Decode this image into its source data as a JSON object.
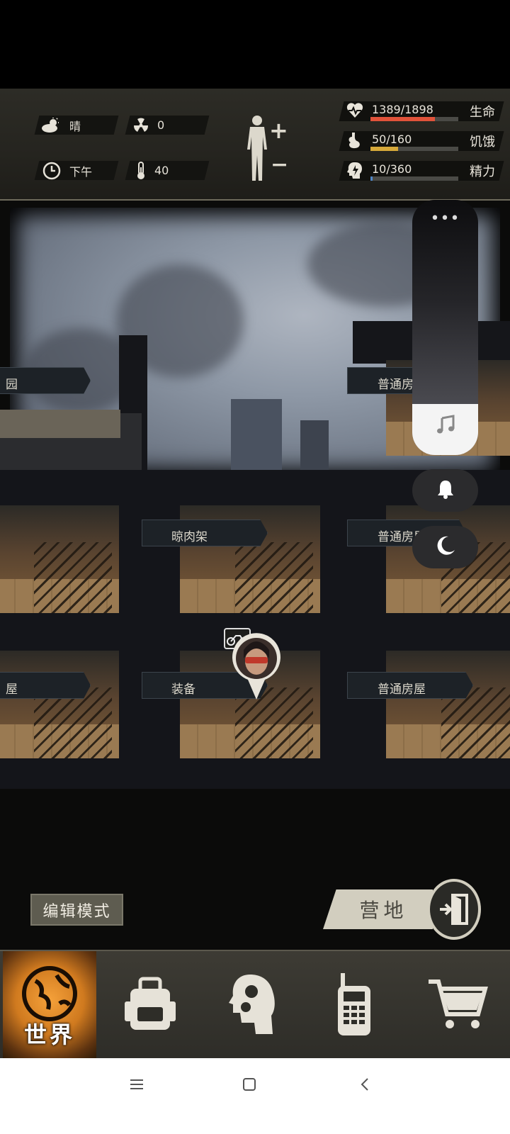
{
  "status": {
    "weather": {
      "icon": "cloud-sun-icon",
      "label": "晴"
    },
    "radiation": {
      "icon": "radiation-icon",
      "value": "0"
    },
    "time": {
      "icon": "clock-icon",
      "label": "下午"
    },
    "temperature": {
      "icon": "thermometer-icon",
      "value": "40"
    },
    "body": {
      "icon": "human-figure-icon",
      "plus": "+",
      "minus": "−"
    },
    "stats": [
      {
        "icon": "heart-pulse-icon",
        "value": "1389/1898",
        "label": "生命",
        "fraction": 0.732,
        "color": "#e0533a"
      },
      {
        "icon": "stomach-icon",
        "value": "50/160",
        "label": "饥饿",
        "fraction": 0.3125,
        "color": "#d6a93a"
      },
      {
        "icon": "head-energy-icon",
        "value": "10/360",
        "label": "精力",
        "fraction": 0.028,
        "color": "#4f86c6"
      }
    ]
  },
  "scene": {
    "rooms": [
      {
        "label": "园"
      },
      {
        "label": "普通房"
      },
      {
        "label": "晾肉架"
      },
      {
        "label": "普通房屋"
      },
      {
        "label": "屋"
      },
      {
        "label": "装备"
      },
      {
        "label": "普通房屋"
      }
    ],
    "player_marker": {
      "icon": "player-avatar-icon",
      "vehicle": "motorcycle-icon"
    }
  },
  "actions": {
    "edit_mode": "编辑模式",
    "camp": "营地",
    "exit_icon": "exit-door-icon"
  },
  "overlay": {
    "volume_level": 0.2,
    "more": "•••",
    "music_icon": "music-note-icon",
    "bell_icon": "bell-icon",
    "moon_icon": "moon-icon"
  },
  "bottom_nav": {
    "tabs": [
      {
        "id": "world",
        "label": "世界",
        "icon": "globe-icon",
        "active": true
      },
      {
        "id": "backpack",
        "icon": "backpack-icon"
      },
      {
        "id": "skills",
        "icon": "head-gears-icon"
      },
      {
        "id": "radio",
        "icon": "walkie-talkie-icon"
      },
      {
        "id": "shop",
        "icon": "shopping-cart-icon"
      }
    ]
  },
  "system_nav": {
    "menu_icon": "menu-icon",
    "home_icon": "home-square-icon",
    "back_icon": "back-chevron-icon"
  }
}
